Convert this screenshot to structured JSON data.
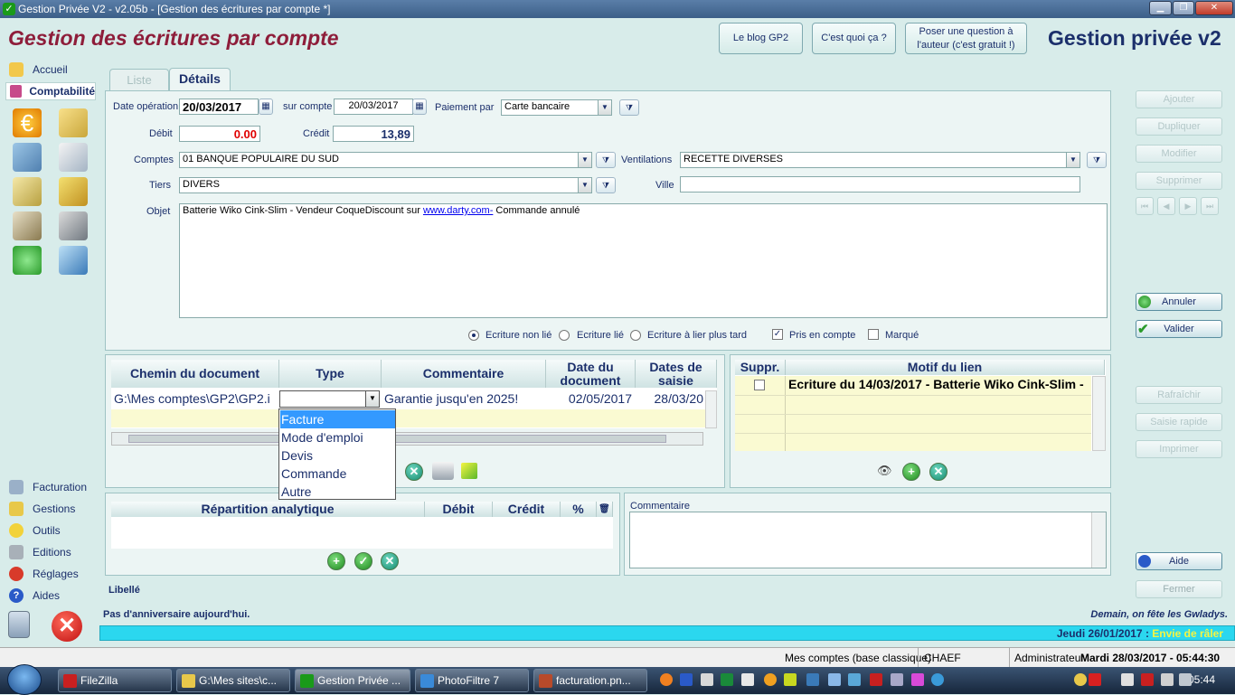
{
  "window": {
    "title": "Gestion Privée V2 - v2.05b - [Gestion des écritures par compte *]"
  },
  "header": {
    "page_title": "Gestion des écritures par compte",
    "brand": "Gestion privée v2",
    "blog_button": "Le blog GP2",
    "whatis_button": "C'est quoi ça ?",
    "question_button_line1": "Poser une question à",
    "question_button_line2": "l'auteur (c'est gratuit !)"
  },
  "sidebar": {
    "accueil": "Accueil",
    "comptabilite": "Comptabilité",
    "bottom": [
      "Facturation",
      "Gestions",
      "Outils",
      "Editions",
      "Réglages",
      "Aides"
    ]
  },
  "tabs": {
    "liste": "Liste",
    "details": "Détails"
  },
  "form": {
    "date_operation_label": "Date opération",
    "date_operation": "20/03/2017",
    "sur_compte_label": "sur compte",
    "sur_compte": "20/03/2017",
    "paiement_label": "Paiement par",
    "paiement": "Carte bancaire",
    "debit_label": "Débit",
    "debit": "0.00",
    "credit_label": "Crédit",
    "credit": "13,89",
    "comptes_label": "Comptes",
    "comptes": "01 BANQUE POPULAIRE DU SUD",
    "ventilations_label": "Ventilations",
    "ventilations": "RECETTE DIVERSES",
    "tiers_label": "Tiers",
    "tiers": "DIVERS",
    "ville_label": "Ville",
    "ville": "",
    "objet_label": "Objet",
    "objet_before": "Batterie Wiko Cink-Slim - Vendeur CoqueDiscount sur ",
    "objet_link": "www.darty.com-",
    "objet_after": " Commande annulé",
    "radio_non_lie": "Ecriture non lié",
    "radio_lie": "Ecriture lié",
    "radio_plus_tard": "Ecriture à lier plus tard",
    "pris_en_compte": "Pris en compte",
    "marque": "Marqué"
  },
  "docs_grid": {
    "headers": [
      "Chemin du document",
      "Type",
      "Commentaire",
      "Date du document",
      "Dates de saisie"
    ],
    "row": {
      "chemin": "G:\\Mes comptes\\GP2\\GP2.i",
      "type": "",
      "commentaire": "Garantie jusqu'en 2025!",
      "date_doc": "02/05/2017",
      "date_saisie": "28/03/20"
    }
  },
  "type_dropdown": {
    "options": [
      "Facture",
      "Mode d'emploi",
      "Devis",
      "Commande",
      "Autre"
    ],
    "selected": "Facture"
  },
  "links_grid": {
    "headers": [
      "Suppr.",
      "Motif du lien"
    ],
    "row": "Ecriture du 14/03/2017 - Batterie Wiko Cink-Slim -"
  },
  "analytic_grid": {
    "headers": [
      "Répartition analytique",
      "Débit",
      "Crédit",
      "%"
    ]
  },
  "commentaire_label": "Commentaire",
  "libelle_label": "Libellé",
  "actions": {
    "ajouter": "Ajouter",
    "dupliquer": "Dupliquer",
    "modifier": "Modifier",
    "supprimer": "Supprimer",
    "annuler": "Annuler",
    "valider": "Valider",
    "rafraichir": "Rafraîchir",
    "saisie_rapide": "Saisie rapide",
    "imprimer": "Imprimer",
    "aide": "Aide",
    "fermer": "Fermer"
  },
  "status": {
    "anniversaire": "Pas d'anniversaire aujourd'hui.",
    "fete": "Demain, on fête les Gwladys.",
    "date_left": "Jeudi 26/01/2017 : ",
    "date_right": "Envie de râler",
    "db": "Mes comptes (base classique)",
    "user": "CHAEF",
    "role": "Administrateur",
    "datetime": "Mardi 28/03/2017 - 05:44:30"
  },
  "taskbar": {
    "items": [
      "FileZilla",
      "G:\\Mes sites\\c...",
      "Gestion Privée ...",
      "PhotoFiltre 7",
      "facturation.pn..."
    ],
    "clock": "05:44"
  },
  "colors": {
    "title_red": "#8e1d3a",
    "navy": "#1b2f6b",
    "debit_red": "#e00000",
    "status_cyan": "#2bd7ef",
    "accent_yellow": "#f5f542"
  }
}
